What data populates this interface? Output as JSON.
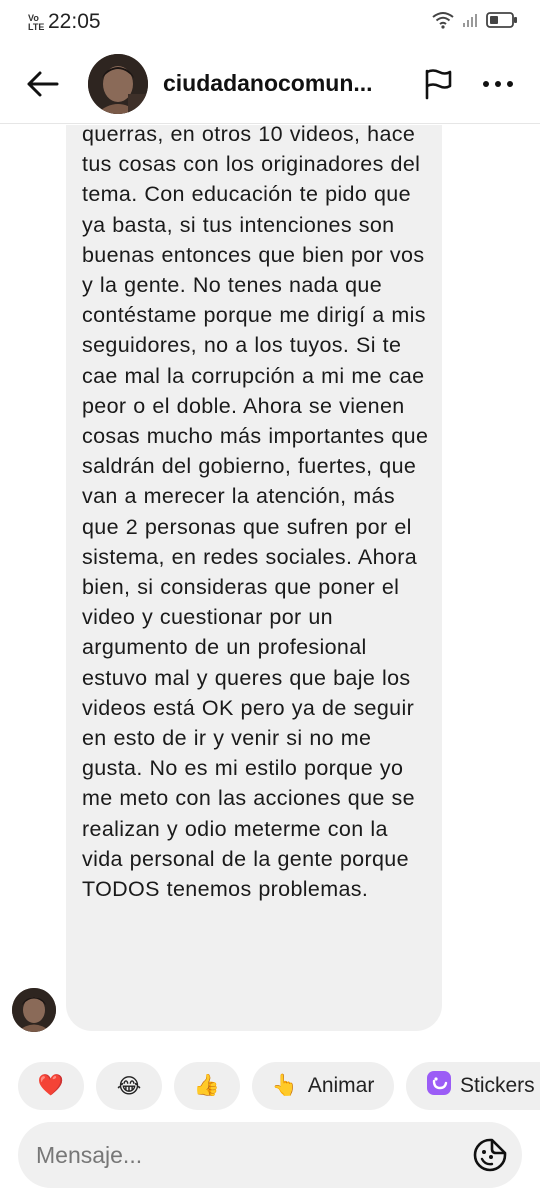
{
  "status_bar": {
    "network_line1": "Vo",
    "network_line2": "LTE",
    "time": "22:05",
    "icons": [
      "wifi-icon",
      "signal-icon",
      "battery-icon"
    ]
  },
  "header": {
    "back_icon": "arrow-left-icon",
    "username": "ciudadanocomun...",
    "flag_icon": "flag-icon",
    "more_icon": "more-dots-icon"
  },
  "message": {
    "text": "querras, en otros 10 videos, hace tus cosas con los originadores del tema. Con educación te pido que ya basta, si tus intenciones son buenas entonces que bien por vos y la gente. No tenes nada que contéstame porque me dirigí a mis seguidores, no a los tuyos. Si te cae mal la corrupción a mi me cae peor o el doble. Ahora se vienen cosas mucho más importantes que saldrán del gobierno, fuertes, que van a merecer la atención, más que 2 personas que sufren por el sistema, en redes sociales. Ahora bien, si consideras que poner el video y cuestionar por un argumento de un profesional estuvo mal y queres que baje los videos está OK pero ya de seguir en esto de ir y venir si no me gusta. No es mi estilo porque yo me meto con las acciones que se realizan y odio meterme con la vida personal de la gente porque TODOS tenemos problemas."
  },
  "quick_replies": [
    {
      "emoji": "❤️",
      "label": ""
    },
    {
      "emoji": "😂",
      "label": ""
    },
    {
      "emoji": "👍",
      "label": ""
    },
    {
      "emoji": "👆",
      "label": "Animar"
    },
    {
      "emoji": "",
      "label": "Stickers"
    }
  ],
  "composer": {
    "placeholder": "Mensaje...",
    "sticker_icon": "sticker-face-icon"
  },
  "colors": {
    "bubble_bg": "#f0f0f0",
    "chip_bg": "#efefef",
    "sticker_accent": "#9b5cf6"
  }
}
